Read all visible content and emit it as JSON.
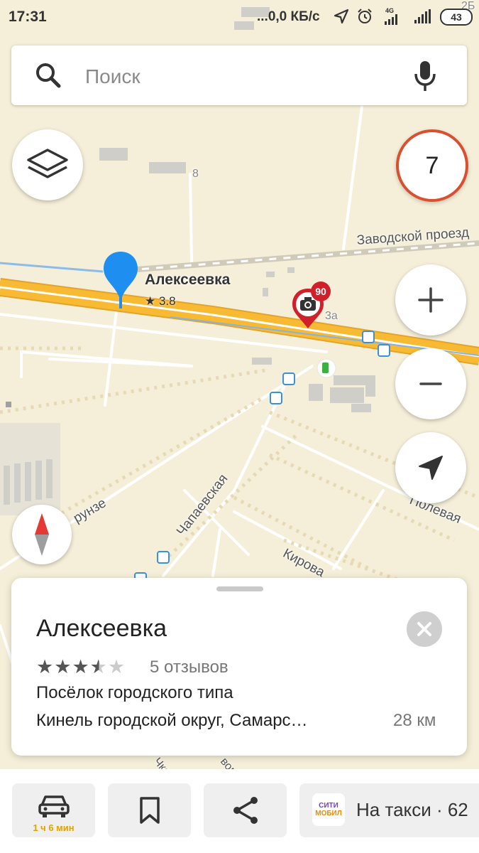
{
  "status_bar": {
    "time": "17:31",
    "network_speed": "...0,0 КБ/с",
    "network_type": "4G",
    "battery": "43"
  },
  "search": {
    "placeholder": "Поиск"
  },
  "speed_limit": {
    "value": "7"
  },
  "map": {
    "selected_place": {
      "name": "Алексеевка",
      "rating": "★ 3.8"
    },
    "speed_camera_limit": "90",
    "labels": {
      "zavodskoy": "Заводской проезд",
      "building_8": "8",
      "building_3a": "3а",
      "building_2b": "2Б",
      "chapaevskaya": "Чапаевская",
      "kirova": "Кирова",
      "polevaya": "Полевая",
      "frunze": "рунзе",
      "bottom_1": "Чка",
      "bottom_2": "вом"
    }
  },
  "place_card": {
    "title": "Алексеевка",
    "rating_value": 3.5,
    "reviews": "5 отзывов",
    "type": "Посёлок городского типа",
    "address": "Кинель городской округ, Самарс…",
    "distance": "28 км"
  },
  "bottom_bar": {
    "route_time": "1 ч 6 мин",
    "taxi_logo_line1": "СИТИ",
    "taxi_logo_line2": "МОБИЛ",
    "taxi_label": "На такси · 62"
  },
  "colors": {
    "map_background": "#f5efd9",
    "highway": "#f8b933",
    "pin_blue": "#1e8ef0",
    "speed_limit_border": "#d9502f",
    "camera_red": "#d0202a",
    "star_filled": "#555555",
    "star_empty": "#cccccc",
    "route_time": "#e2a100"
  }
}
